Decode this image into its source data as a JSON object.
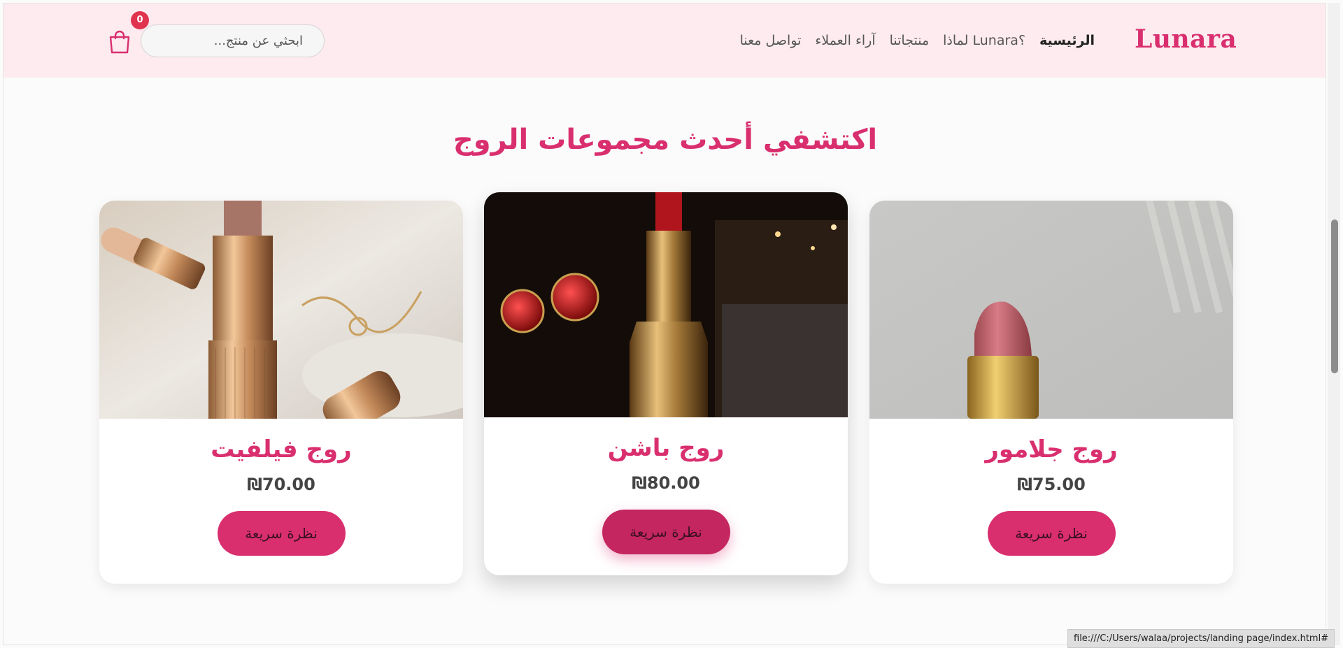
{
  "header": {
    "logo": "Lunara",
    "nav": [
      {
        "label": "الرئيسية",
        "active": true
      },
      {
        "label": "لماذا Lunara؟",
        "active": false
      },
      {
        "label": "منتجاتنا",
        "active": false
      },
      {
        "label": "آراء العملاء",
        "active": false
      },
      {
        "label": "تواصل معنا",
        "active": false
      }
    ],
    "search_placeholder": "ابحثي عن منتج...",
    "cart_count": "0",
    "cart_icon": "shopping-bag-icon"
  },
  "section": {
    "title": "اكتشفي أحدث مجموعات الروج"
  },
  "products": [
    {
      "name": "روج فيلفيت",
      "price": "₪70.00",
      "button": "نظرة سريعة",
      "image": "rose-gold-lipstick-photo"
    },
    {
      "name": "روج باشن",
      "price": "₪80.00",
      "button": "نظرة سريعة",
      "image": "red-lipstick-dark-photo"
    },
    {
      "name": "روج جلامور",
      "price": "₪75.00",
      "button": "نظرة سريعة",
      "image": "pink-lipstick-photo"
    }
  ],
  "status_bar": {
    "url": "file:///C:/Users/walaa/projects/landing page/index.html#"
  },
  "colors": {
    "accent": "#d92f6f",
    "header_bg": "#fdebef",
    "badge": "#e0334f"
  }
}
